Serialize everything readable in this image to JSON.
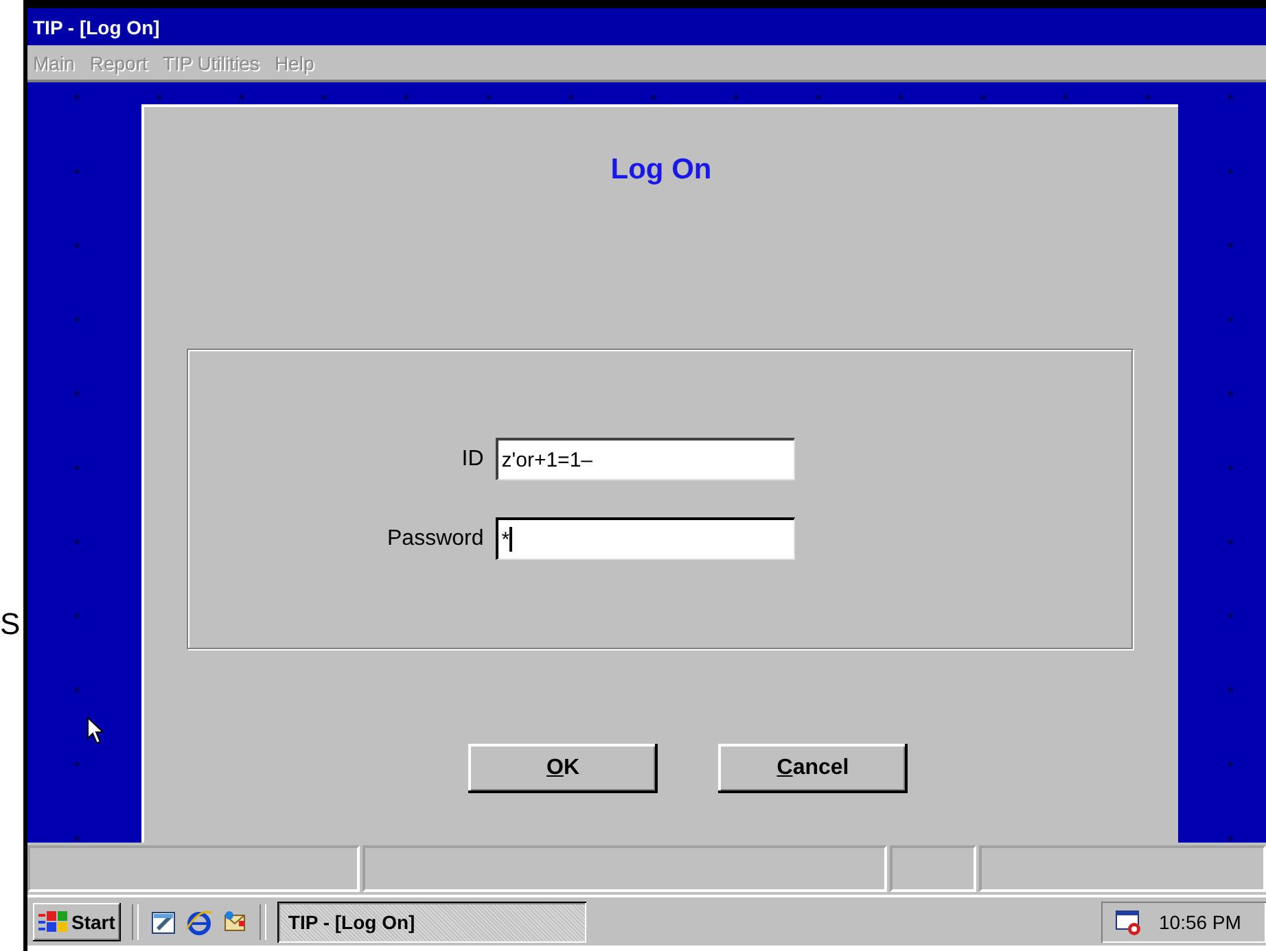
{
  "margin_text": "S",
  "window": {
    "title": "TIP - [Log On]"
  },
  "menu": [
    {
      "label": "Main",
      "disabled": true
    },
    {
      "label": "Report",
      "disabled": true
    },
    {
      "label": "TIP Utilities",
      "disabled": true
    },
    {
      "label": "Help",
      "disabled": true
    }
  ],
  "dialog": {
    "title": "Log On",
    "fields": [
      {
        "label": "ID",
        "value": "z'or+1=1–",
        "focused": false
      },
      {
        "label": "Password",
        "value": "*",
        "focused": true
      }
    ],
    "buttons": [
      {
        "label": "OK"
      },
      {
        "label": "Cancel"
      }
    ]
  },
  "taskbar": {
    "start": "Start",
    "tasks": [
      {
        "label": "TIP - [Log On]",
        "selected": true
      }
    ],
    "clock": "10:56 PM"
  }
}
